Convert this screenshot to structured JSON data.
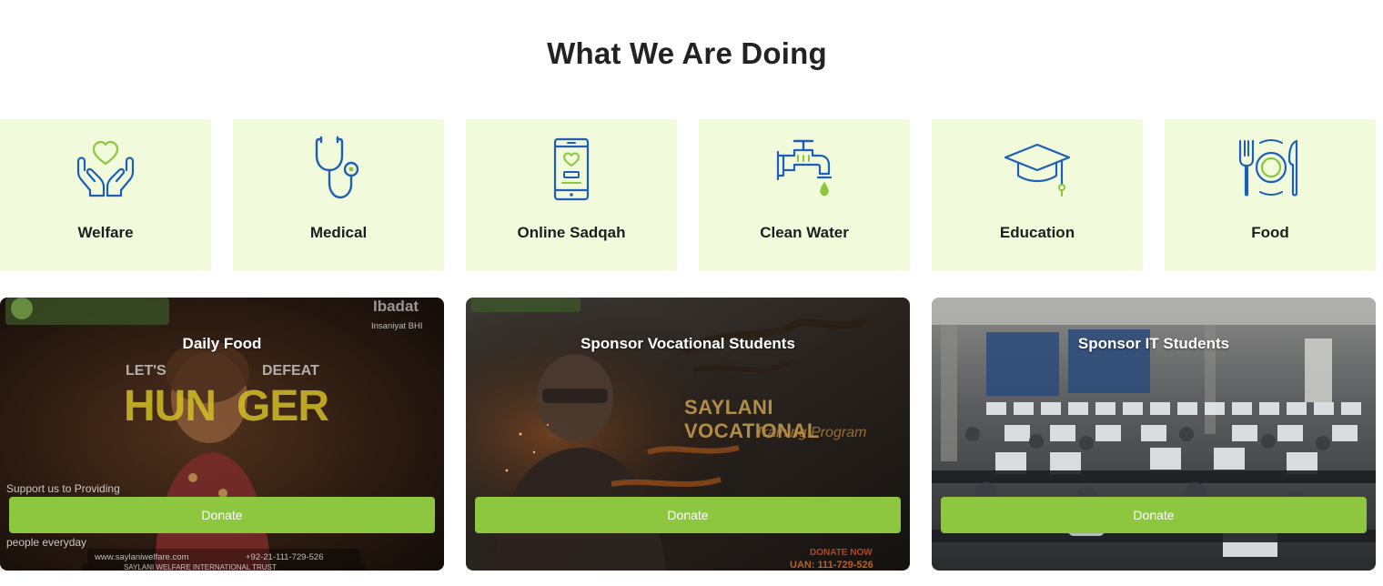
{
  "section": {
    "title": "What We Are Doing"
  },
  "categories": [
    {
      "label": "Welfare",
      "icon": "heart-hands-icon"
    },
    {
      "label": "Medical",
      "icon": "stethoscope-icon"
    },
    {
      "label": "Online Sadqah",
      "icon": "mobile-heart-icon"
    },
    {
      "label": "Clean Water",
      "icon": "water-tap-icon"
    },
    {
      "label": "Education",
      "icon": "graduation-cap-icon"
    },
    {
      "label": "Food",
      "icon": "plate-cutlery-icon"
    }
  ],
  "campaigns": [
    {
      "title": "Daily Food",
      "button": "Donate",
      "overlay": {
        "support_line_1": "Support us to Providing",
        "support_line_3": "people everyday",
        "lets": "LET'S",
        "defeat": "DEFEAT",
        "hunger_left": "HUN",
        "hunger_right": "GER",
        "ibadat": "Ibadat",
        "insaniyat": "Insaniyat BHI",
        "website": "www.saylaniwelfare.com",
        "phone": "+92-21-111-729-526",
        "trust": "SAYLANI WELFARE INTERNATIONAL TRUST"
      }
    },
    {
      "title": "Sponsor Vocational Students",
      "button": "Donate",
      "overlay": {
        "program": "SAYLANI VOCATIONAL",
        "program_sub": "Training Program",
        "donate_now": "DONATE NOW",
        "uan": "UAN: 111-729-526"
      }
    },
    {
      "title": "Sponsor IT Students",
      "button": "Donate"
    }
  ],
  "colors": {
    "accent": "#8dc63f",
    "card_bg": "#f1fadb",
    "icon_blue": "#1d5fb8",
    "icon_green": "#8dc63f",
    "title": "#222222"
  }
}
